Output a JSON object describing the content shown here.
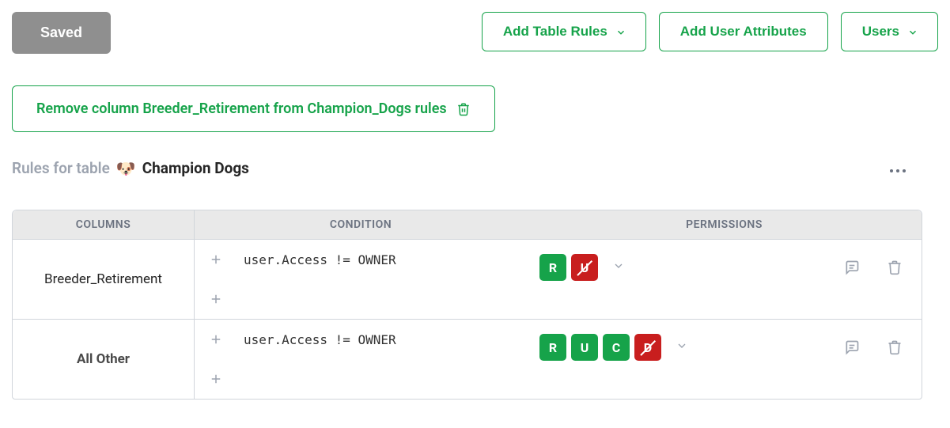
{
  "topbar": {
    "saved_label": "Saved",
    "add_table_rules_label": "Add Table Rules",
    "add_user_attributes_label": "Add User Attributes",
    "users_label": "Users"
  },
  "remove_bar": {
    "text": "Remove column Breeder_Retirement from Champion_Dogs rules"
  },
  "heading": {
    "prefix": "Rules for table",
    "emoji": "🐶",
    "table_name": "Champion Dogs"
  },
  "table": {
    "headers": {
      "columns": "COLUMNS",
      "condition": "CONDITION",
      "permissions": "PERMISSIONS"
    },
    "rows": [
      {
        "column_name": "Breeder_Retirement",
        "column_bold": false,
        "condition": "user.Access != OWNER",
        "permissions": [
          {
            "letter": "R",
            "allowed": true
          },
          {
            "letter": "U",
            "allowed": false
          }
        ]
      },
      {
        "column_name": "All Other",
        "column_bold": true,
        "condition": "user.Access != OWNER",
        "permissions": [
          {
            "letter": "R",
            "allowed": true
          },
          {
            "letter": "U",
            "allowed": true
          },
          {
            "letter": "C",
            "allowed": true
          },
          {
            "letter": "D",
            "allowed": false
          }
        ]
      }
    ]
  }
}
